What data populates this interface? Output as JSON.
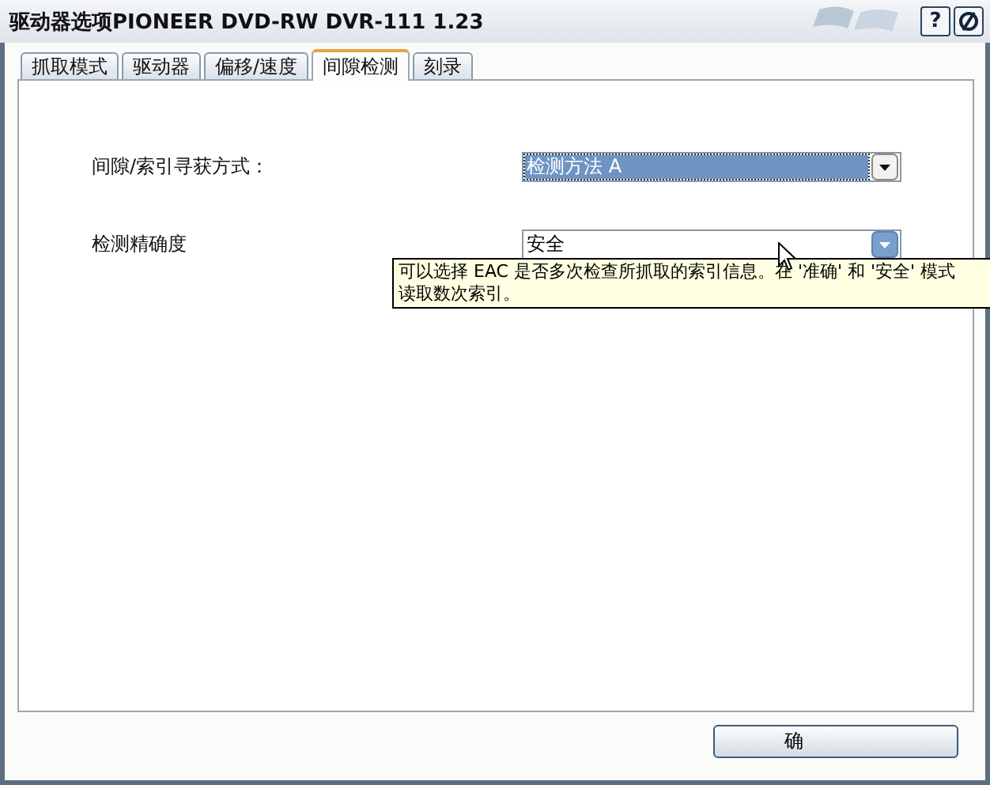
{
  "window": {
    "title": "驱动器选项PIONEER DVD-RW  DVR-111 1.23",
    "help_button": "?"
  },
  "tabs": [
    {
      "label": "抓取模式",
      "selected": false
    },
    {
      "label": "驱动器",
      "selected": false
    },
    {
      "label": "偏移/速度",
      "selected": false
    },
    {
      "label": "间隙检测",
      "selected": true
    },
    {
      "label": "刻录",
      "selected": false
    }
  ],
  "settings": [
    {
      "label": "间隙/索引寻获方式：",
      "value": "检测方法 A",
      "focused": true
    },
    {
      "label": "检测精确度",
      "value": "安全",
      "focused": false
    }
  ],
  "tooltip": {
    "lines": [
      "可以选择 EAC 是否多次检查所抓取的索引信息。在 '准确' 和 '安全' 模式",
      "读取数次索引。"
    ]
  },
  "buttons": [
    "确"
  ]
}
